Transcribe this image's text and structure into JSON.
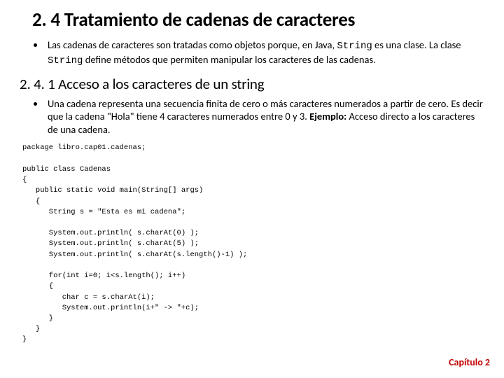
{
  "title": "2. 4 Tratamiento de cadenas de caracteres",
  "intro": {
    "pre": "Las cadenas de caracteres son tratadas como objetos porque, en Java, ",
    "code1": "String",
    "mid": " es una clase. La clase ",
    "code2": "String",
    "post": " define métodos que permiten manipular los caracteres de las cadenas."
  },
  "subtitle": "2. 4. 1 Acceso a los caracteres de un string",
  "desc": {
    "text": "Una cadena representa una secuencia finita de cero o más caracteres numerados a partir de cero. Es decir que la cadena \"Hola\" tiene 4 caracteres numerados entre 0 y 3. ",
    "bold": "Ejemplo:",
    "after": " Acceso directo a los caracteres de una cadena."
  },
  "code": "package libro.cap01.cadenas;\n\npublic class Cadenas\n{\n   public static void main(String[] args)\n   {\n      String s = \"Esta es mi cadena\";\n\n      System.out.println( s.charAt(0) );\n      System.out.println( s.charAt(5) );\n      System.out.println( s.charAt(s.length()-1) );\n\n      for(int i=0; i<s.length(); i++)\n      {\n         char c = s.charAt(i);\n         System.out.println(i+\" -> \"+c);\n      }\n   }\n}",
  "chapter": "Capítulo 2"
}
